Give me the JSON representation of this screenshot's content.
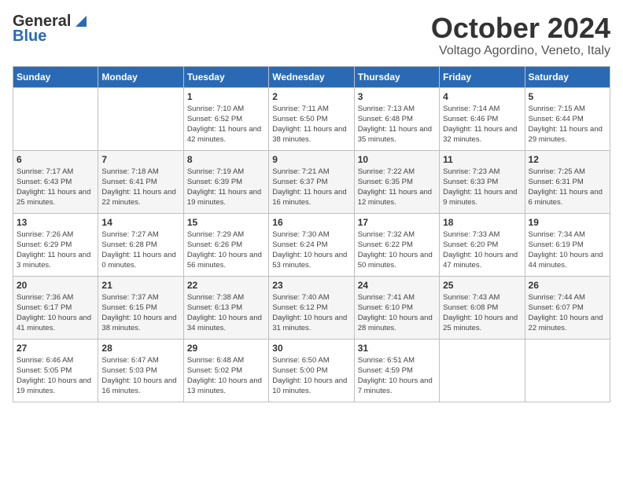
{
  "logo": {
    "general": "General",
    "blue": "Blue"
  },
  "header": {
    "month": "October 2024",
    "location": "Voltago Agordino, Veneto, Italy"
  },
  "days": [
    "Sunday",
    "Monday",
    "Tuesday",
    "Wednesday",
    "Thursday",
    "Friday",
    "Saturday"
  ],
  "weeks": [
    [
      {
        "day": "",
        "content": ""
      },
      {
        "day": "",
        "content": ""
      },
      {
        "day": "1",
        "content": "Sunrise: 7:10 AM\nSunset: 6:52 PM\nDaylight: 11 hours and 42 minutes."
      },
      {
        "day": "2",
        "content": "Sunrise: 7:11 AM\nSunset: 6:50 PM\nDaylight: 11 hours and 38 minutes."
      },
      {
        "day": "3",
        "content": "Sunrise: 7:13 AM\nSunset: 6:48 PM\nDaylight: 11 hours and 35 minutes."
      },
      {
        "day": "4",
        "content": "Sunrise: 7:14 AM\nSunset: 6:46 PM\nDaylight: 11 hours and 32 minutes."
      },
      {
        "day": "5",
        "content": "Sunrise: 7:15 AM\nSunset: 6:44 PM\nDaylight: 11 hours and 29 minutes."
      }
    ],
    [
      {
        "day": "6",
        "content": "Sunrise: 7:17 AM\nSunset: 6:43 PM\nDaylight: 11 hours and 25 minutes."
      },
      {
        "day": "7",
        "content": "Sunrise: 7:18 AM\nSunset: 6:41 PM\nDaylight: 11 hours and 22 minutes."
      },
      {
        "day": "8",
        "content": "Sunrise: 7:19 AM\nSunset: 6:39 PM\nDaylight: 11 hours and 19 minutes."
      },
      {
        "day": "9",
        "content": "Sunrise: 7:21 AM\nSunset: 6:37 PM\nDaylight: 11 hours and 16 minutes."
      },
      {
        "day": "10",
        "content": "Sunrise: 7:22 AM\nSunset: 6:35 PM\nDaylight: 11 hours and 12 minutes."
      },
      {
        "day": "11",
        "content": "Sunrise: 7:23 AM\nSunset: 6:33 PM\nDaylight: 11 hours and 9 minutes."
      },
      {
        "day": "12",
        "content": "Sunrise: 7:25 AM\nSunset: 6:31 PM\nDaylight: 11 hours and 6 minutes."
      }
    ],
    [
      {
        "day": "13",
        "content": "Sunrise: 7:26 AM\nSunset: 6:29 PM\nDaylight: 11 hours and 3 minutes."
      },
      {
        "day": "14",
        "content": "Sunrise: 7:27 AM\nSunset: 6:28 PM\nDaylight: 11 hours and 0 minutes."
      },
      {
        "day": "15",
        "content": "Sunrise: 7:29 AM\nSunset: 6:26 PM\nDaylight: 10 hours and 56 minutes."
      },
      {
        "day": "16",
        "content": "Sunrise: 7:30 AM\nSunset: 6:24 PM\nDaylight: 10 hours and 53 minutes."
      },
      {
        "day": "17",
        "content": "Sunrise: 7:32 AM\nSunset: 6:22 PM\nDaylight: 10 hours and 50 minutes."
      },
      {
        "day": "18",
        "content": "Sunrise: 7:33 AM\nSunset: 6:20 PM\nDaylight: 10 hours and 47 minutes."
      },
      {
        "day": "19",
        "content": "Sunrise: 7:34 AM\nSunset: 6:19 PM\nDaylight: 10 hours and 44 minutes."
      }
    ],
    [
      {
        "day": "20",
        "content": "Sunrise: 7:36 AM\nSunset: 6:17 PM\nDaylight: 10 hours and 41 minutes."
      },
      {
        "day": "21",
        "content": "Sunrise: 7:37 AM\nSunset: 6:15 PM\nDaylight: 10 hours and 38 minutes."
      },
      {
        "day": "22",
        "content": "Sunrise: 7:38 AM\nSunset: 6:13 PM\nDaylight: 10 hours and 34 minutes."
      },
      {
        "day": "23",
        "content": "Sunrise: 7:40 AM\nSunset: 6:12 PM\nDaylight: 10 hours and 31 minutes."
      },
      {
        "day": "24",
        "content": "Sunrise: 7:41 AM\nSunset: 6:10 PM\nDaylight: 10 hours and 28 minutes."
      },
      {
        "day": "25",
        "content": "Sunrise: 7:43 AM\nSunset: 6:08 PM\nDaylight: 10 hours and 25 minutes."
      },
      {
        "day": "26",
        "content": "Sunrise: 7:44 AM\nSunset: 6:07 PM\nDaylight: 10 hours and 22 minutes."
      }
    ],
    [
      {
        "day": "27",
        "content": "Sunrise: 6:46 AM\nSunset: 5:05 PM\nDaylight: 10 hours and 19 minutes."
      },
      {
        "day": "28",
        "content": "Sunrise: 6:47 AM\nSunset: 5:03 PM\nDaylight: 10 hours and 16 minutes."
      },
      {
        "day": "29",
        "content": "Sunrise: 6:48 AM\nSunset: 5:02 PM\nDaylight: 10 hours and 13 minutes."
      },
      {
        "day": "30",
        "content": "Sunrise: 6:50 AM\nSunset: 5:00 PM\nDaylight: 10 hours and 10 minutes."
      },
      {
        "day": "31",
        "content": "Sunrise: 6:51 AM\nSunset: 4:59 PM\nDaylight: 10 hours and 7 minutes."
      },
      {
        "day": "",
        "content": ""
      },
      {
        "day": "",
        "content": ""
      }
    ]
  ]
}
